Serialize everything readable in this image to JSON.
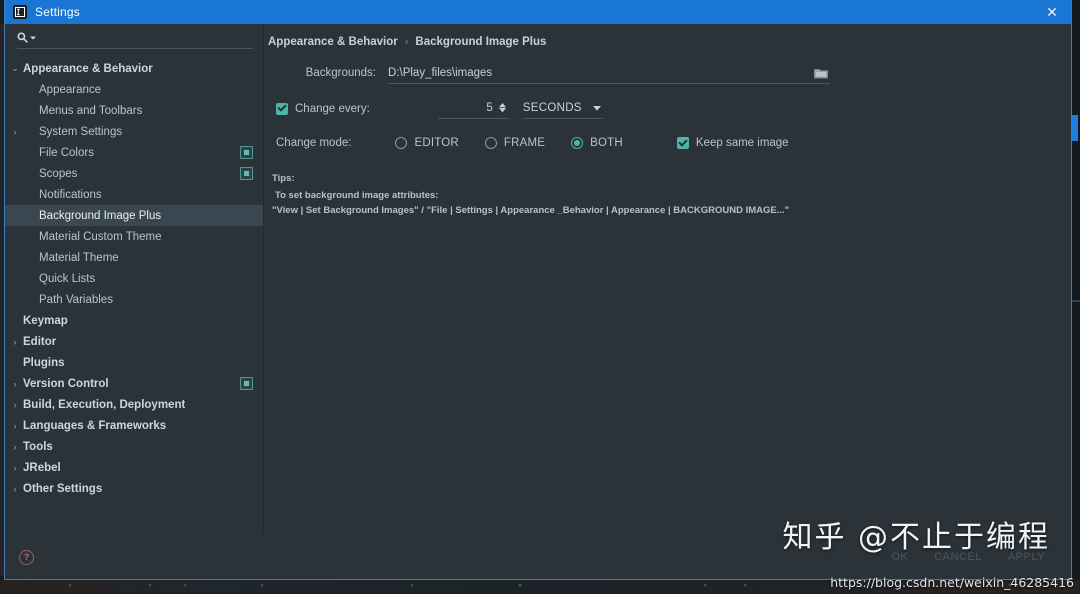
{
  "window": {
    "title": "Settings",
    "app_icon": "intellij-icon",
    "close_label": "✕",
    "titlebar_color": "#1976d2"
  },
  "search": {
    "value": "",
    "placeholder": "",
    "icon": "search-icon",
    "dropdown_icon": "chevron-down-icon"
  },
  "sidebar": {
    "items": [
      {
        "label": "Appearance & Behavior",
        "indent": 0,
        "arrow": "expanded",
        "bold": true,
        "selected": false,
        "badge": false
      },
      {
        "label": "Appearance",
        "indent": 1,
        "arrow": "none",
        "bold": false,
        "selected": false,
        "badge": false
      },
      {
        "label": "Menus and Toolbars",
        "indent": 1,
        "arrow": "none",
        "bold": false,
        "selected": false,
        "badge": false
      },
      {
        "label": "System Settings",
        "indent": 1,
        "arrow": "collapsed",
        "bold": false,
        "selected": false,
        "badge": false
      },
      {
        "label": "File Colors",
        "indent": 1,
        "arrow": "none",
        "bold": false,
        "selected": false,
        "badge": true
      },
      {
        "label": "Scopes",
        "indent": 1,
        "arrow": "none",
        "bold": false,
        "selected": false,
        "badge": true
      },
      {
        "label": "Notifications",
        "indent": 1,
        "arrow": "none",
        "bold": false,
        "selected": false,
        "badge": false
      },
      {
        "label": "Background Image Plus",
        "indent": 1,
        "arrow": "none",
        "bold": false,
        "selected": true,
        "badge": false
      },
      {
        "label": "Material Custom Theme",
        "indent": 1,
        "arrow": "none",
        "bold": false,
        "selected": false,
        "badge": false
      },
      {
        "label": "Material Theme",
        "indent": 1,
        "arrow": "none",
        "bold": false,
        "selected": false,
        "badge": false
      },
      {
        "label": "Quick Lists",
        "indent": 1,
        "arrow": "none",
        "bold": false,
        "selected": false,
        "badge": false
      },
      {
        "label": "Path Variables",
        "indent": 1,
        "arrow": "none",
        "bold": false,
        "selected": false,
        "badge": false
      },
      {
        "label": "Keymap",
        "indent": 0,
        "arrow": "none",
        "bold": true,
        "selected": false,
        "badge": false
      },
      {
        "label": "Editor",
        "indent": 0,
        "arrow": "collapsed",
        "bold": true,
        "selected": false,
        "badge": false
      },
      {
        "label": "Plugins",
        "indent": 0,
        "arrow": "none",
        "bold": true,
        "selected": false,
        "badge": false
      },
      {
        "label": "Version Control",
        "indent": 0,
        "arrow": "collapsed",
        "bold": true,
        "selected": false,
        "badge": true
      },
      {
        "label": "Build, Execution, Deployment",
        "indent": 0,
        "arrow": "collapsed",
        "bold": true,
        "selected": false,
        "badge": false
      },
      {
        "label": "Languages & Frameworks",
        "indent": 0,
        "arrow": "collapsed",
        "bold": true,
        "selected": false,
        "badge": false
      },
      {
        "label": "Tools",
        "indent": 0,
        "arrow": "collapsed",
        "bold": true,
        "selected": false,
        "badge": false
      },
      {
        "label": "JRebel",
        "indent": 0,
        "arrow": "collapsed",
        "bold": true,
        "selected": false,
        "badge": false
      },
      {
        "label": "Other Settings",
        "indent": 0,
        "arrow": "collapsed",
        "bold": true,
        "selected": false,
        "badge": false
      }
    ]
  },
  "breadcrumb": {
    "parent": "Appearance & Behavior",
    "separator": "›",
    "current": "Background Image Plus"
  },
  "form": {
    "backgrounds_label": "Backgrounds:",
    "backgrounds_value": "D:\\Play_files\\images",
    "backgrounds_placeholder": "",
    "browse_icon": "folder-icon",
    "change_every_label": "Change every:",
    "change_every_checked": true,
    "interval_value": "5",
    "spinner_up_icon": "caret-up-icon",
    "spinner_down_icon": "caret-down-icon",
    "unit_value": "SECONDS",
    "unit_caret_icon": "chevron-down-icon",
    "change_mode_label": "Change mode:",
    "modes": [
      {
        "label": "EDITOR",
        "selected": false
      },
      {
        "label": "FRAME",
        "selected": false
      },
      {
        "label": "BOTH",
        "selected": true
      }
    ],
    "keep_same_image_label": "Keep same image",
    "keep_same_image_checked": true
  },
  "tips": {
    "heading": "Tips:",
    "line1": "To set background image attributes:",
    "line2": "\"View | Set Background Images\" / \"File | Settings | Appearance _Behavior | Appearance | BACKGROUND IMAGE...\""
  },
  "footer": {
    "help_icon": "question-mark-icon",
    "help_label": "?",
    "ok_label": "OK",
    "cancel_label": "CANCEL",
    "apply_label": "APPLY"
  },
  "watermark": {
    "text": "知乎 @不止于编程",
    "url": "https://blog.csdn.net/weixin_46285416"
  },
  "colors": {
    "accent_teal": "#4fb3a5",
    "title_blue": "#1976d2",
    "dialog_bg": "#2b3339",
    "selection": "#3a4750"
  }
}
